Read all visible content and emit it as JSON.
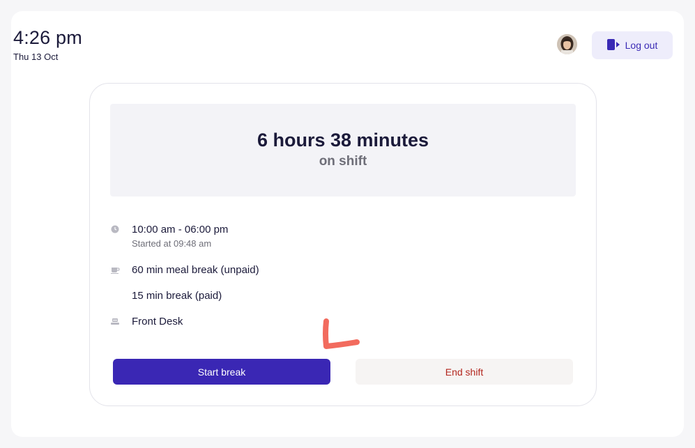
{
  "header": {
    "time": "4:26 pm",
    "date": "Thu 13 Oct",
    "logout_label": "Log out"
  },
  "shift": {
    "duration": "6 hours 38 minutes",
    "status": "on shift",
    "schedule": "10:00 am - 06:00 pm",
    "started_at": "Started at 09:48 am",
    "meal_break": "60 min meal break (unpaid)",
    "short_break": "15 min break (paid)",
    "location": "Front Desk"
  },
  "actions": {
    "start_break_label": "Start break",
    "end_shift_label": "End shift"
  },
  "colors": {
    "primary": "#3a27b4",
    "danger": "#b3261e",
    "annotation": "#f26b5e"
  },
  "icons": {
    "schedule": "clock-icon",
    "meal_break": "coffee-cup-icon",
    "location": "desk-icon",
    "logout": "logout-icon"
  }
}
